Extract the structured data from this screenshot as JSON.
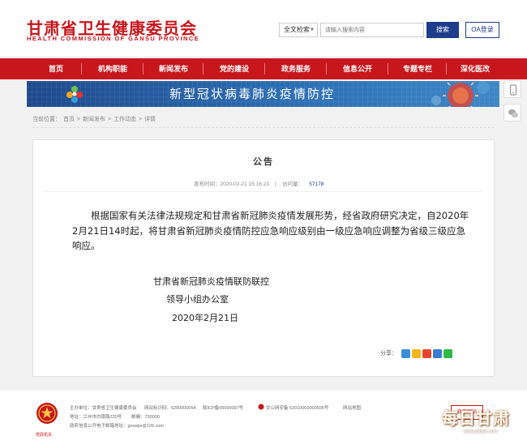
{
  "header": {
    "logo_cn": "甘肃省卫生健康委员会",
    "logo_en": "HEALTH COMMISSION OF GANSU PROVINCE",
    "search_scope": "全文检索",
    "search_placeholder": "请输入搜索内容",
    "search_button": "搜索",
    "oa_button": "OA登录"
  },
  "nav": {
    "items": [
      "首页",
      "机构职能",
      "新闻发布",
      "党的建设",
      "政务服务",
      "信息公开",
      "专题专栏",
      "深化医改"
    ]
  },
  "banner": {
    "title": "新型冠状病毒肺炎疫情防控"
  },
  "side_icons": [
    "mobile-icon",
    "wechat-icon"
  ],
  "breadcrumb": {
    "label": "当前位置：",
    "items": [
      "首页",
      "新闻发布",
      "工作动态",
      "详情"
    ],
    "sep": ">"
  },
  "article": {
    "title": "公告",
    "publish_label": "发布时间：",
    "publish_time": "2020-02-21 15:16:23",
    "views_label": "访问量：",
    "views": "57178",
    "body": "根据国家有关法律法规规定和甘肃省新冠肺炎疫情发展形势，经省政府研究决定，自2020年2月21日14时起，将甘肃省新冠肺炎疫情防控应急响应级别由一级应急响应调整为省级三级应急响应。",
    "signature_line1": "甘肃省新冠肺炎疫情联防联控",
    "signature_line2": "领导小组办公室",
    "date": "2020年2月21日",
    "share_label": "分享："
  },
  "colors": {
    "brand_red": "#c8161d",
    "nav_blue": "#1e3c8c",
    "banner_blue": "#2b6db3"
  },
  "footer": {
    "line1_a": "主办单位：甘肃省卫生健康委员会",
    "line1_b": "网站标识码：6200000054",
    "line1_c": "陇ICP备05000097号",
    "line1_d": "甘公网安备 62010002000505号",
    "line1_e": "网站地图",
    "line2": "地址：兰州市白银路220号",
    "line2_b": "邮编：730000",
    "line3": "政府信息公开电子邮箱地址：gsswjw@126.com",
    "emblem_label": "党政机关",
    "gov_badge": "政府网站"
  },
  "watermark": {
    "text": "每日甘肃",
    "url": "www.dxbei.com"
  }
}
